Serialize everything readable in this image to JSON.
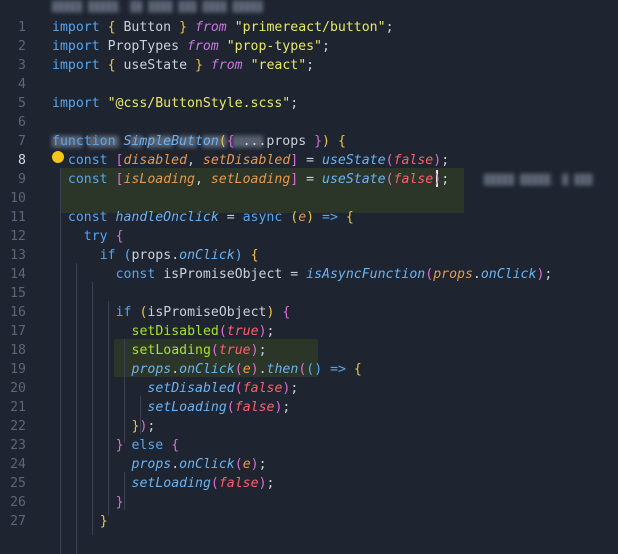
{
  "editor": {
    "active_line": 8,
    "blurred_hints": [
      "█████ █████, ██ ████ ███ ████ █████",
      "█████ █████, ██ ████ ███ ████ █████",
      "█████ █████, █ ███"
    ],
    "line_numbers": [
      "1",
      "2",
      "3",
      "4",
      "5",
      "6",
      "7",
      "8",
      "9",
      "10",
      "11",
      "12",
      "13",
      "14",
      "15",
      "16",
      "17",
      "18",
      "19",
      "20",
      "21",
      "22",
      "23",
      "24",
      "25",
      "26",
      "27"
    ],
    "lines": {
      "l1": [
        "import",
        " ",
        "{",
        " Button ",
        "}",
        " ",
        "from",
        " ",
        "\"primereact/button\"",
        ";"
      ],
      "l2": [
        "import",
        " PropTypes ",
        "from",
        " ",
        "\"prop-types\"",
        ";"
      ],
      "l3": [
        "import",
        " ",
        "{",
        " useState ",
        "}",
        " ",
        "from",
        " ",
        "\"react\"",
        ";"
      ],
      "l5": [
        "import",
        " ",
        "\"@css/ButtonStyle.scss\"",
        ";"
      ],
      "l7": [
        "function",
        " ",
        "SimpleButton",
        "(",
        "{",
        " ...props ",
        "}",
        ")",
        " ",
        "{"
      ],
      "l8": [
        "const",
        " ",
        "[",
        "disabled",
        ", ",
        "setDisabled",
        "]",
        " = ",
        "useState",
        "(",
        "false",
        ")",
        ";"
      ],
      "l9": [
        "const",
        " ",
        "[",
        "isLoading",
        ", ",
        "setLoading",
        "]",
        " = ",
        "useState",
        "(",
        "false",
        ")",
        ";"
      ],
      "l11": [
        "const",
        " ",
        "handleOnclick",
        " = ",
        "async",
        " ",
        "(",
        "e",
        ")",
        " => ",
        "{"
      ],
      "l12": [
        "try",
        " ",
        "{"
      ],
      "l13": [
        "if",
        " ",
        "(",
        "props",
        ".",
        "onClick",
        ")",
        " ",
        "{"
      ],
      "l14": [
        "const",
        " isPromiseObject = ",
        "isAsyncFunction",
        "(",
        "props",
        ".",
        "onClick",
        ")",
        ";"
      ],
      "l16": [
        "if",
        " ",
        "(",
        "isPromiseObject",
        ")",
        " ",
        "{"
      ],
      "l17": [
        "setDisabled",
        "(",
        "true",
        ")",
        ";"
      ],
      "l18": [
        "setLoading",
        "(",
        "true",
        ")",
        ";"
      ],
      "l19": [
        "props",
        ".",
        "onClick",
        "(",
        "e",
        ")",
        ".",
        "then",
        "(",
        "()",
        " => ",
        "{"
      ],
      "l20": [
        "setDisabled",
        "(",
        "false",
        ")",
        ";"
      ],
      "l21": [
        "setLoading",
        "(",
        "false",
        ")",
        ";"
      ],
      "l22": [
        "}",
        ")",
        ";"
      ],
      "l23": [
        "}",
        " else ",
        "{"
      ],
      "l24": [
        "props",
        ".",
        "onClick",
        "(",
        "e",
        ")",
        ";"
      ],
      "l25": [
        "setLoading",
        "(",
        "false",
        ")",
        ";"
      ],
      "l26": [
        "}"
      ],
      "l27": [
        "}"
      ]
    }
  }
}
